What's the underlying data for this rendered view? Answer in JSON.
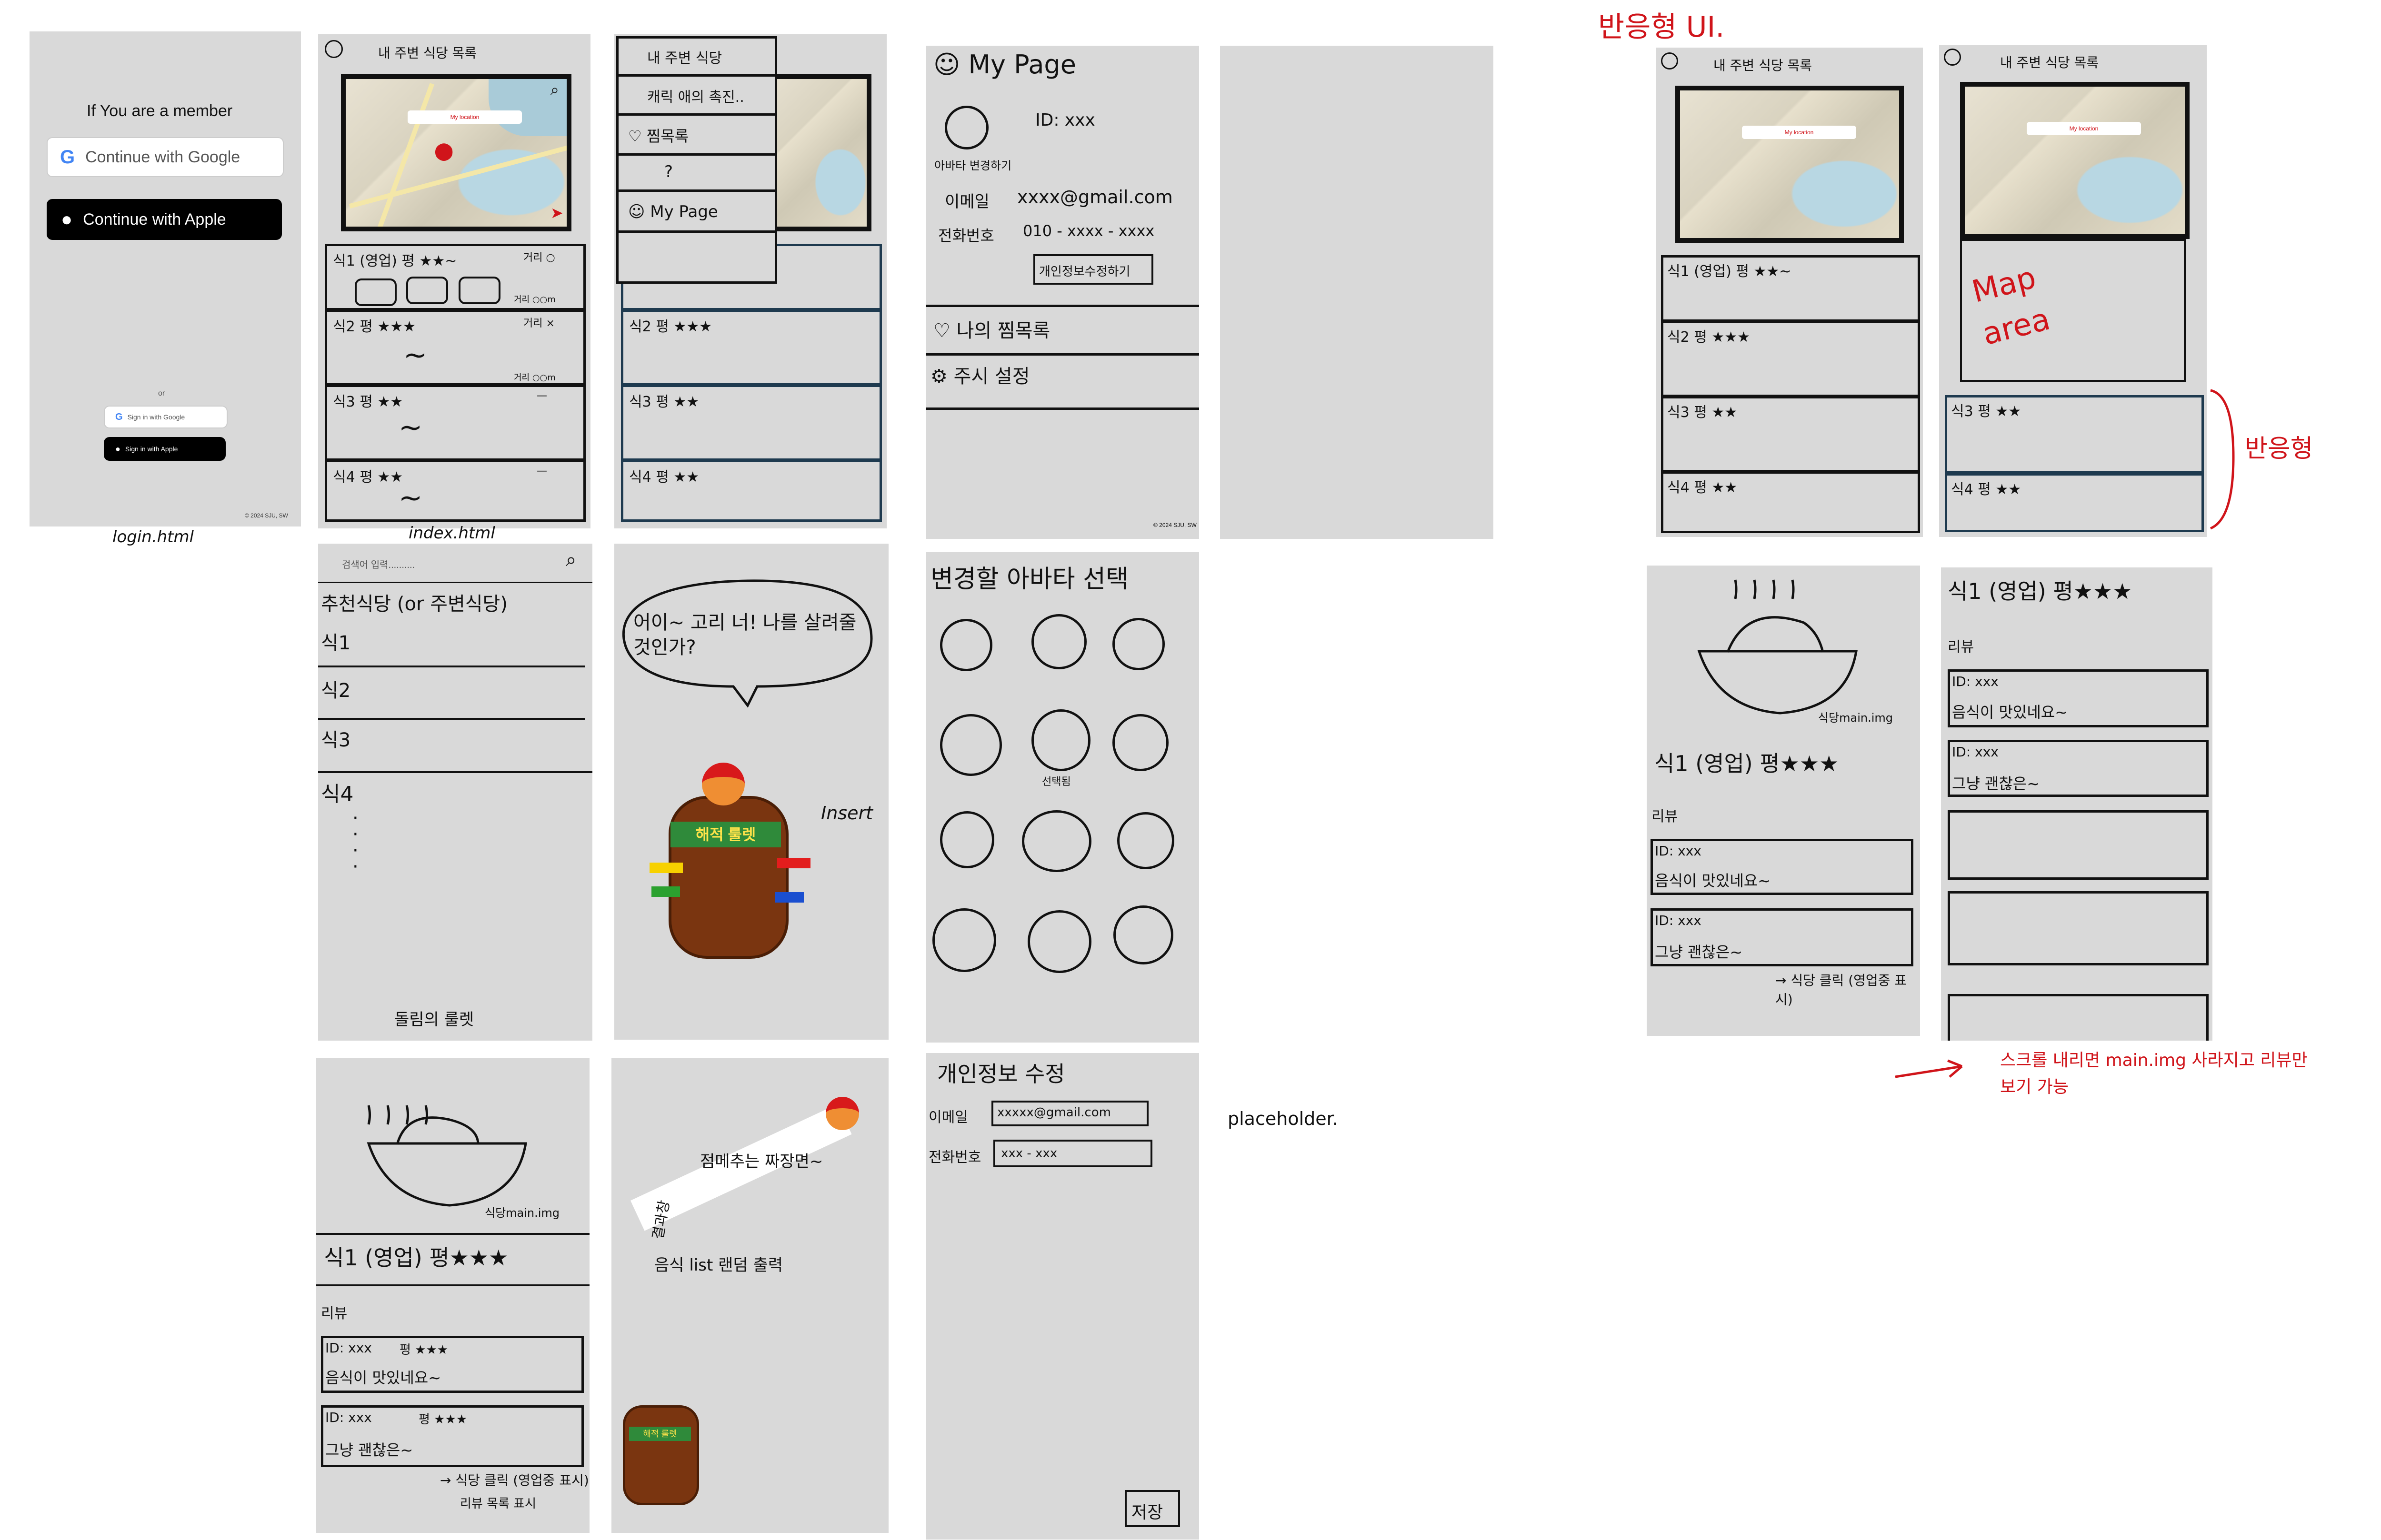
{
  "login": {
    "heading": "If You are a member",
    "google_btn": "Continue with Google",
    "apple_btn": "Continue with Apple",
    "or": "or",
    "google_small": "Sign in with Google",
    "apple_small": "Sign in with Apple",
    "copyright": "© 2024 SJU, SW",
    "caption": "login.html"
  },
  "index": {
    "nav": "내 주변  식당  목록",
    "map_label": "My location",
    "rows": [
      {
        "title": "식1 (영업) 평 ★★~",
        "right": "거리 ○",
        "extra": "거리 ○○m"
      },
      {
        "title": "식2 평 ★★★",
        "right": "거리 ×",
        "extra": "거리 ○○m"
      },
      {
        "title": "식3 평 ★★",
        "right": "—",
        "extra": "~"
      },
      {
        "title": "식4 평 ★★",
        "right": "—",
        "extra": "~"
      }
    ],
    "caption": "index.html"
  },
  "menu": {
    "items": [
      "내 주변 식당",
      "캐릭 애의 촉진..",
      "찜목록",
      "?",
      "My Page"
    ]
  },
  "mypage": {
    "title": "My Page",
    "id_line": "ID: xxx",
    "avatar_label": "아바타 변경하기",
    "email_label": "이메일",
    "email_value": "xxxx@gmail.com",
    "phone_label": "전화번호",
    "phone_value": "010 - xxxx - xxxx",
    "edit_btn": "개인정보수정하기",
    "wishlist": "나의 찜목록",
    "settings": "주시 설정",
    "copyright": "© 2024 SJU, SW"
  },
  "search": {
    "placeholder": "검색어 입력..........",
    "heading": "추천식당 (or 주변식당)",
    "items": [
      "식1",
      "식2",
      "식3",
      "식4"
    ],
    "footer": "돌림의 룰렛"
  },
  "game": {
    "speech": "어이~ 고리 너! 나를 살려줄 것인가?",
    "insert": "Insert",
    "barrel_text": "해적 룰렛"
  },
  "avatar_select": {
    "title": "변경할 아바타 선택",
    "selected_label": "선택됨"
  },
  "detail": {
    "img_caption": "식당main.img",
    "title": "식1 (영업) 평★★★",
    "review_head": "리뷰",
    "reviews": [
      {
        "id": "ID: xxx",
        "stars": "평 ★★★",
        "text": "음식이 맛있네요~"
      },
      {
        "id": "ID: xxx",
        "stars": "평 ★★★",
        "text": "그냥 괜찮은~"
      }
    ],
    "note": "→ 식당 클릭 (영업중 표시)",
    "note2": "리뷰 목록 표시"
  },
  "result": {
    "speech": "점메추는 짜장면~",
    "label": "결과창",
    "arrow_text": "음식 list 랜덤 출력",
    "mini_barrel": "해적 룰렛"
  },
  "edit": {
    "title": "개인정보 수정",
    "email_label": "이메일",
    "email_value": "xxxxx@gmail.com",
    "phone_label": "전화번호",
    "phone_value": "xxx - xxx",
    "placeholder_note": "placeholder.",
    "save": "저장"
  },
  "responsive": {
    "title": "반응형 UI.",
    "map_area": "Map area",
    "side_note": "반응형",
    "scroll_note": "스크롤 내리면 main.img 사라지고 리뷰만 보기 가능"
  },
  "colors": {
    "panel": "#d9d9d9",
    "ink": "#111111",
    "red": "#d0141a",
    "navy_border": "#1e3a4f"
  }
}
